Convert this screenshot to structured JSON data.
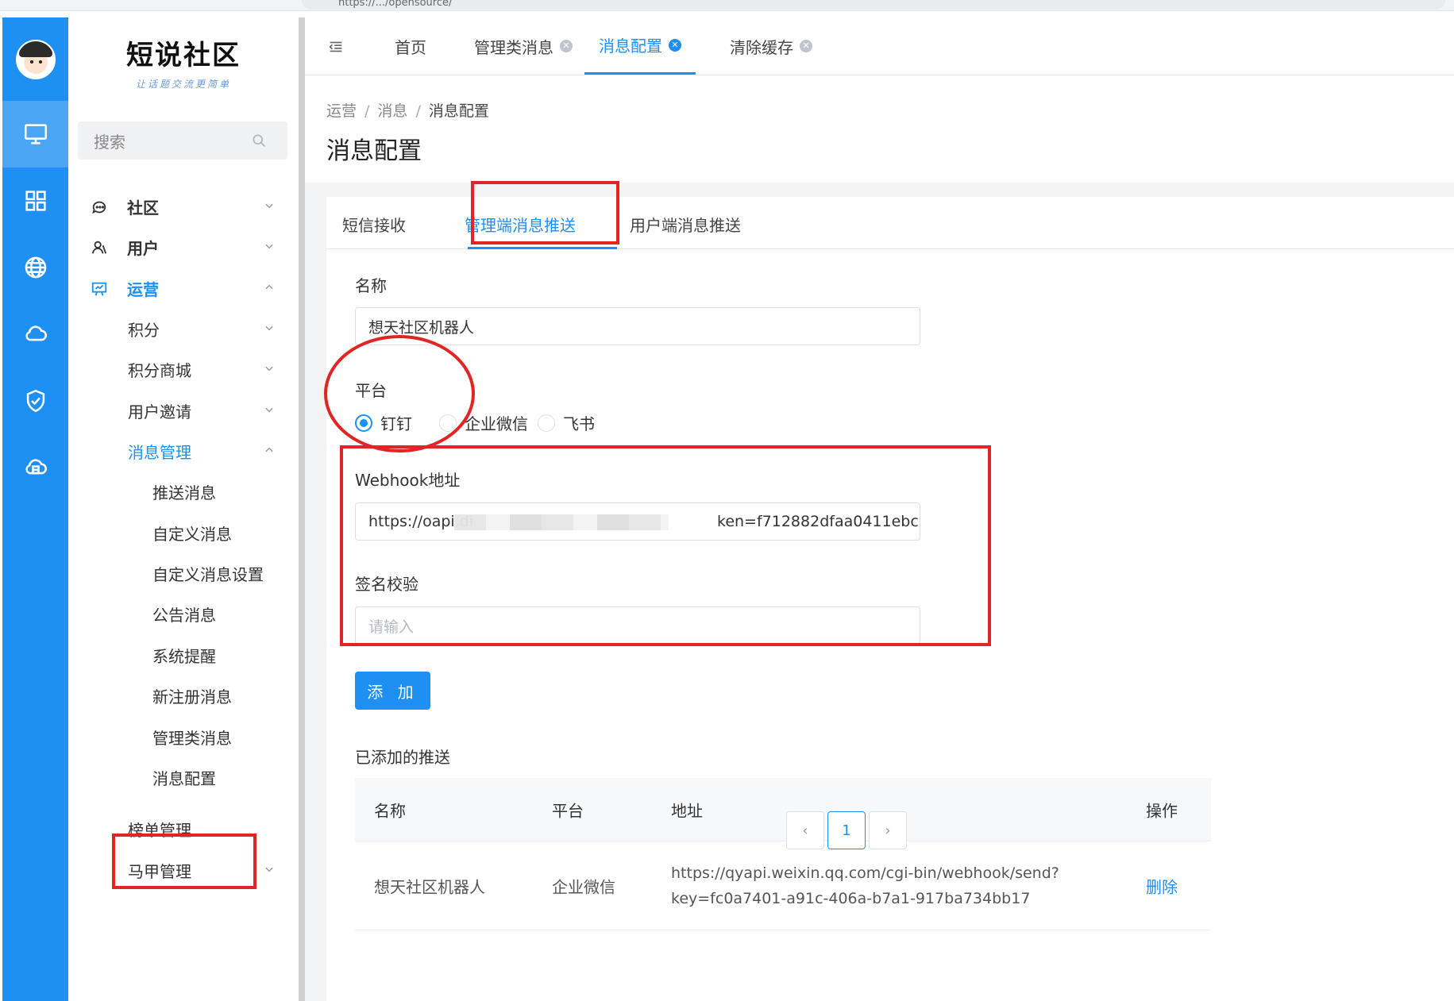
{
  "browser": {
    "url_text": "https://.../opensource/"
  },
  "logo": {
    "title": "短说社区",
    "subtitle": "让话题交流更简单"
  },
  "search": {
    "placeholder": "搜索"
  },
  "rail": {
    "items": [
      {
        "icon": "monitor-icon",
        "active": true
      },
      {
        "icon": "grid-icon"
      },
      {
        "icon": "globe-icon"
      },
      {
        "icon": "cloud-icon"
      },
      {
        "icon": "shield-check-icon"
      },
      {
        "icon": "cloud-storage-icon"
      }
    ]
  },
  "menu": {
    "community": "社区",
    "user": "用户",
    "operations": "运营",
    "points": "积分",
    "points_mall": "积分商城",
    "user_invite": "用户邀请",
    "message_mgmt": "消息管理",
    "push_message": "推送消息",
    "custom_message": "自定义消息",
    "custom_message_settings": "自定义消息设置",
    "announcement": "公告消息",
    "system_reminder": "系统提醒",
    "new_register_message": "新注册消息",
    "admin_message": "管理类消息",
    "message_config": "消息配置",
    "ranking_mgmt": "榜单管理",
    "vest_mgmt": "马甲管理"
  },
  "top_tabs": {
    "home": "首页",
    "admin_messages": "管理类消息",
    "message_config": "消息配置",
    "clear_cache": "清除缓存"
  },
  "breadcrumb": {
    "level1": "运营",
    "level2": "消息",
    "level3": "消息配置",
    "separator": "/"
  },
  "page_title": "消息配置",
  "sub_tabs": {
    "sms": "短信接收",
    "admin_push": "管理端消息推送",
    "user_push": "用户端消息推送"
  },
  "form": {
    "name_label": "名称",
    "name_value": "想天社区机器人",
    "platform_label": "平台",
    "platforms": [
      "钉钉",
      "企业微信",
      "飞书"
    ],
    "selected_platform": "钉钉",
    "webhook_label": "Webhook地址",
    "webhook_value_start": "https://oapi.di",
    "webhook_value_end": "ken=f712882dfaa0411ebc",
    "sign_label": "签名校验",
    "sign_placeholder": "请输入",
    "add_button": "添 加"
  },
  "added_section": {
    "title": "已添加的推送",
    "columns": {
      "name": "名称",
      "platform": "平台",
      "address": "地址",
      "action": "操作"
    },
    "rows": [
      {
        "name": "想天社区机器人",
        "platform": "企业微信",
        "address_line1": "https://qyapi.weixin.qq.com/cgi-bin/webhook/send?",
        "address_line2": "key=fc0a7401-a91c-406a-b7a1-917ba734bb17",
        "action": "删除"
      }
    ]
  },
  "pagination": {
    "prev": "‹",
    "current_page": "1",
    "next": "›"
  },
  "colors": {
    "brand": "#1e8ff3",
    "annotation_red": "#e22424"
  }
}
